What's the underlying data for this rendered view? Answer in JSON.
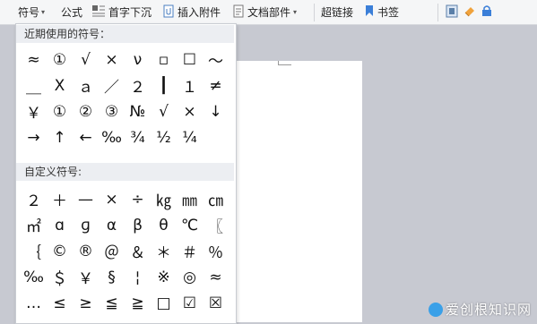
{
  "toolbar": {
    "symbol_label": "符号",
    "formula_label": "公式",
    "dropcap_label": "首字下沉",
    "insert_attachment_label": "插入附件",
    "doc_parts_label": "文档部件",
    "hyperlink_label": "超链接",
    "bookmark_label": "书签",
    "icons": [
      "dropdown-arrow-icon",
      "dropcap-icon",
      "attachment-icon",
      "doc-parts-icon",
      "bookmark-icon",
      "doc-icon",
      "eraser-icon",
      "lock-icon"
    ]
  },
  "symbol_panel": {
    "recent_title": "近期使用的符号：",
    "recent_symbols": [
      "≈",
      "①",
      "√",
      "×",
      "ν",
      "▫",
      "☐",
      "～",
      "＿",
      "Ⅹ",
      "ａ",
      "／",
      "２",
      "┃",
      "１",
      "≠",
      "￥",
      "①",
      "②",
      "③",
      "№",
      "√",
      "×",
      "↓",
      "→",
      "↑",
      "←",
      "‰",
      "¾",
      "½",
      "¼"
    ],
    "custom_title": "自定义符号:",
    "custom_symbols": [
      "２",
      "＋",
      "—",
      "×",
      "÷",
      "㎏",
      "㎜",
      "㎝",
      "㎡",
      "ɑ",
      "ɡ",
      "α",
      "β",
      "θ",
      "℃",
      "〖",
      "｛",
      "©",
      "®",
      "＠",
      "＆",
      "＊",
      "＃",
      "％",
      "‰",
      "＄",
      "￥",
      "§",
      "¦",
      "※",
      "◎",
      "≈",
      "…",
      "≤",
      "≥",
      "≦",
      "≧",
      "□",
      "☑",
      "☒"
    ]
  },
  "watermark": {
    "text": "爱创根知识网"
  },
  "colors": {
    "toolbar_bg": "#f5f6f7",
    "workspace_bg": "#c7c9d1",
    "section_bg": "#eceef2",
    "accent": "#2e7bd6"
  }
}
